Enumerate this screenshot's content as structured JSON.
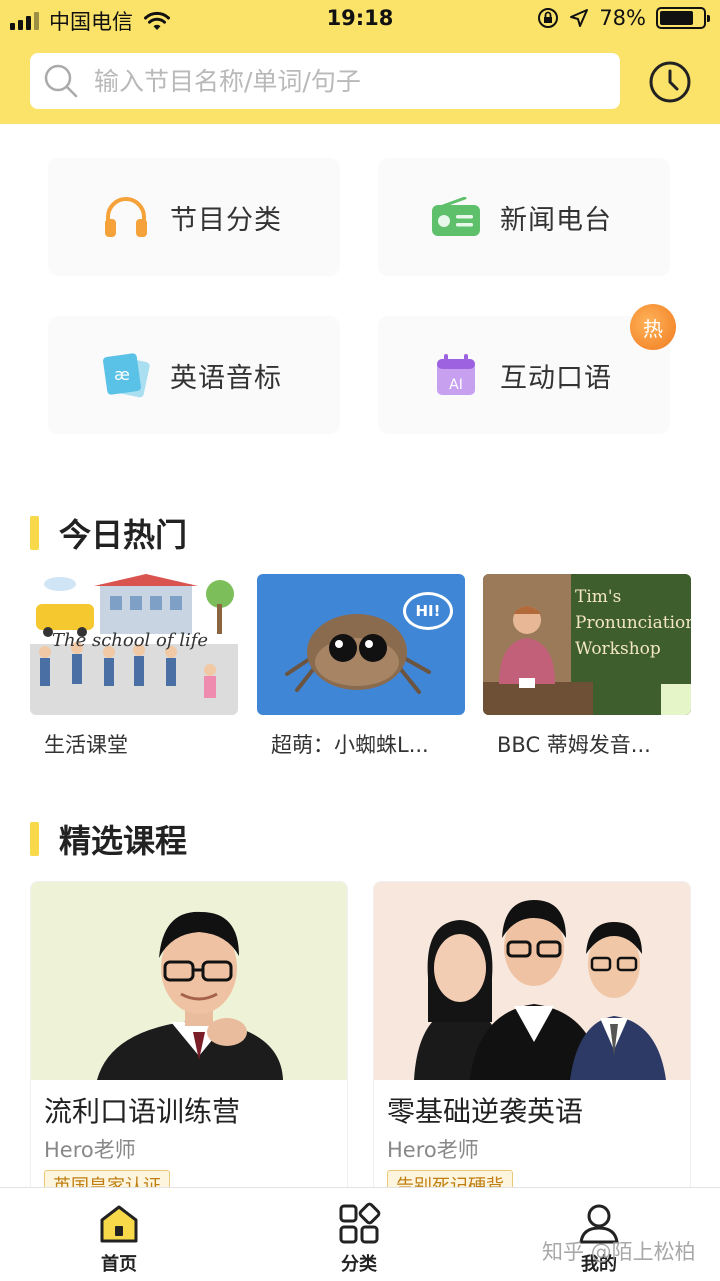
{
  "status_bar": {
    "carrier": "中国电信",
    "time": "19:18",
    "battery": "78%",
    "battery_level": 0.78
  },
  "search": {
    "placeholder": "输入节目名称/单词/句子",
    "icon": "search-icon",
    "history_icon": "clock-icon"
  },
  "shortcuts": [
    {
      "label": "节目分类",
      "icon": "headphones-icon",
      "color": "#f5a23a"
    },
    {
      "label": "新闻电台",
      "icon": "radio-icon",
      "color": "#5ec06b"
    },
    {
      "label": "英语音标",
      "icon": "phonetic-card-icon",
      "color": "#5bc2e7"
    },
    {
      "label": "互动口语",
      "icon": "calendar-ai-icon",
      "color": "#b37ee8"
    }
  ],
  "hot_badge": "热",
  "today_hot": {
    "title": "今日热门",
    "items": [
      {
        "caption": "生活课堂",
        "image_text": "The school of life"
      },
      {
        "caption": "超萌：小蜘蛛L...",
        "image_text": "HI!"
      },
      {
        "caption": "BBC 蒂姆发音...",
        "image_text": "Tim's Pronunciation Workshop"
      }
    ]
  },
  "courses": {
    "title": "精选课程",
    "items": [
      {
        "title": "流利口语训练营",
        "teacher": "Hero老师",
        "tag": "英国皇家认证",
        "bg": "#eef3d8"
      },
      {
        "title": "零基础逆袭英语",
        "teacher": "Hero老师",
        "tag": "告别死记硬背",
        "bg": "#f7e7dc"
      }
    ]
  },
  "tabs": [
    {
      "label": "首页",
      "icon": "home-icon",
      "active": true
    },
    {
      "label": "分类",
      "icon": "category-grid-icon",
      "active": false
    },
    {
      "label": "我的",
      "icon": "profile-icon",
      "active": false
    }
  ],
  "watermark": "知乎 @陌上松柏"
}
